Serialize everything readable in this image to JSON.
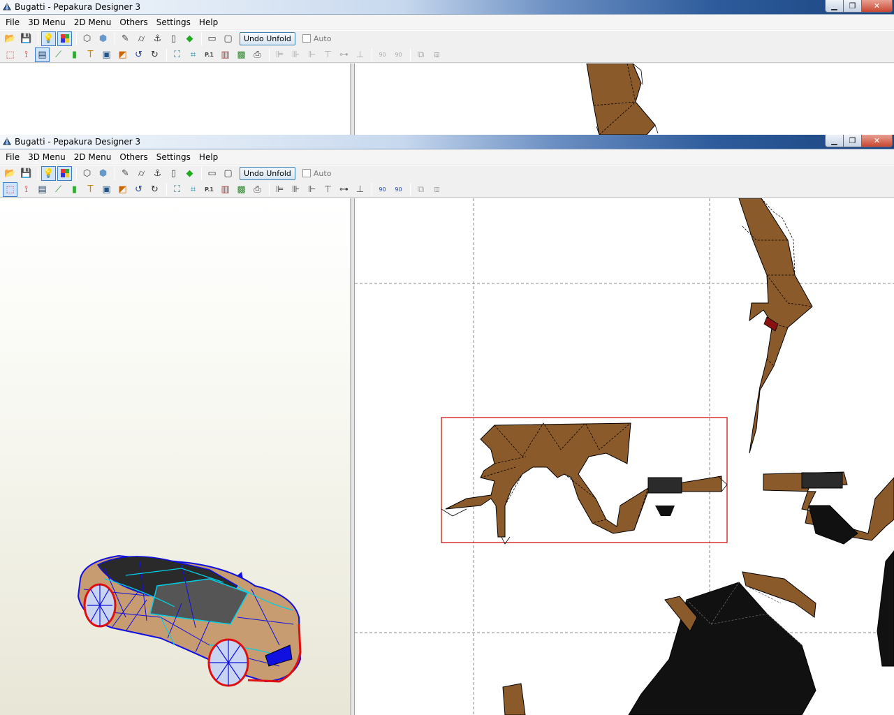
{
  "windows": [
    {
      "title": "Bugatti - Pepakura Designer 3",
      "menu": [
        "File",
        "3D Menu",
        "2D Menu",
        "Others",
        "Settings",
        "Help"
      ],
      "undo_unfold_label": "Undo Unfold",
      "auto_label": "Auto",
      "auto_checked": false,
      "bulb_active": true,
      "texture_active": true,
      "paper_tool_active": true
    },
    {
      "title": "Bugatti - Pepakura Designer 3",
      "menu": [
        "File",
        "3D Menu",
        "2D Menu",
        "Others",
        "Settings",
        "Help"
      ],
      "undo_unfold_label": "Undo Unfold",
      "auto_label": "Auto",
      "auto_checked": false,
      "bulb_active": true,
      "texture_active": true,
      "select_tool_active": true
    }
  ],
  "toolbar1_icons": [
    "open-icon",
    "save-icon",
    "bulb-icon",
    "texture-icon",
    "cube-wire-icon",
    "cube-shade-icon",
    "pencil-icon",
    "cylinder-icon",
    "anchor-icon",
    "edge-icon",
    "green-cube-icon",
    "single-view-icon",
    "dual-view-icon"
  ],
  "toolbar2_icons": [
    "select-icon",
    "join-icon",
    "paper-icon",
    "brush-icon",
    "part-icon",
    "text-icon",
    "image-icon",
    "flap-icon",
    "rotate-icon",
    "mirror-icon",
    "fit-icon",
    "arrange-icon",
    "page-number-icon",
    "layout-icon",
    "preview-icon",
    "print-icon",
    "align-left-icon",
    "align-center-icon",
    "align-right-icon",
    "align-top-icon",
    "align-middle-icon",
    "align-bottom-icon",
    "rotate-ccw-90-icon",
    "rotate-cw-90-icon",
    "group-icon",
    "ungroup-icon"
  ],
  "page_labels": {
    "rot_ccw": "90",
    "rot_cw": "90",
    "page_num": "P.1"
  },
  "colors": {
    "part_brown": "#8b5a2b",
    "part_black": "#111111",
    "selection_red": "#d00000",
    "wire_blue": "#1010e0",
    "wire_cyan": "#00d0e8"
  }
}
